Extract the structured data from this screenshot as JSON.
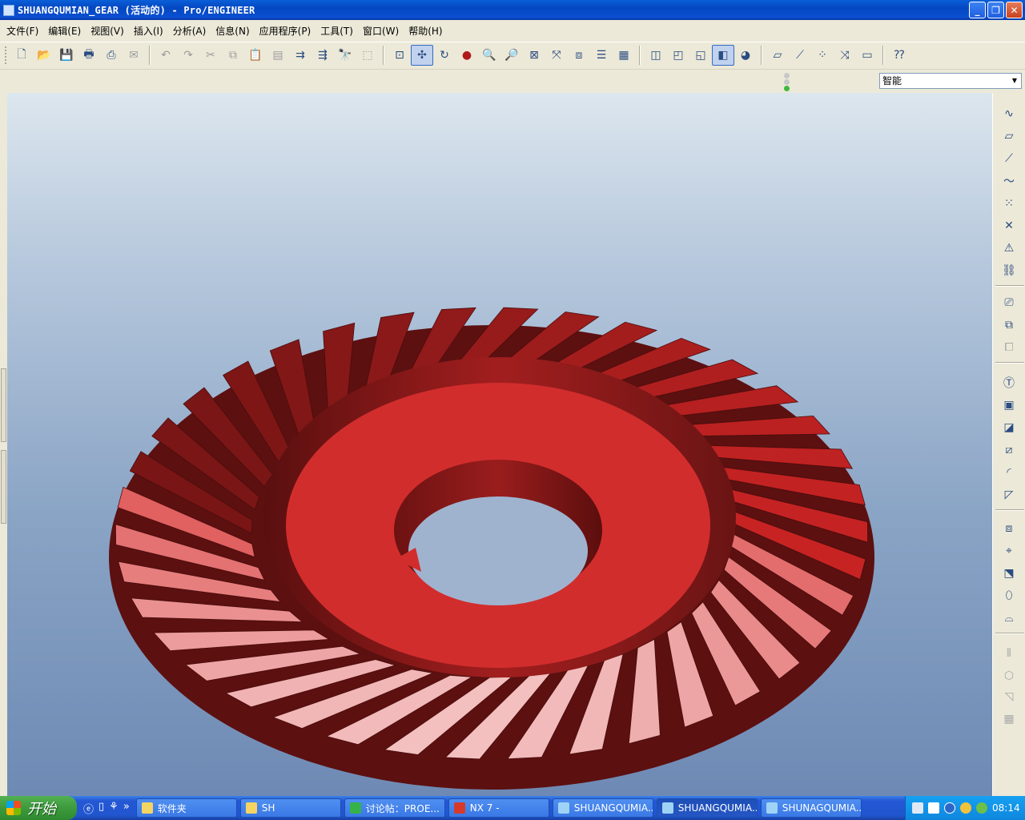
{
  "window": {
    "title": "SHUANGQUMIAN_GEAR (活动的) - Pro/ENGINEER",
    "controls": {
      "minimize": "_",
      "maximize": "❐",
      "close": "✕"
    }
  },
  "menu": [
    {
      "label": "文件(F)"
    },
    {
      "label": "编辑(E)"
    },
    {
      "label": "视图(V)"
    },
    {
      "label": "插入(I)"
    },
    {
      "label": "分析(A)"
    },
    {
      "label": "信息(N)"
    },
    {
      "label": "应用程序(P)"
    },
    {
      "label": "工具(T)"
    },
    {
      "label": "窗口(W)"
    },
    {
      "label": "帮助(H)"
    }
  ],
  "toolbar": {
    "icons": [
      "new-file-icon",
      "open-file-icon",
      "save-icon",
      "print-icon",
      "print-preview-icon",
      "email-icon",
      "undo-icon",
      "redo-icon",
      "cut-icon",
      "copy-icon",
      "paste-icon",
      "paste-special-icon",
      "regenerate-icon",
      "regen-manager-icon",
      "find-icon",
      "select-box-icon",
      "repaint-icon",
      "spin-center-icon",
      "orient-mode-icon",
      "appearance-icon",
      "zoom-in-icon",
      "zoom-out-icon",
      "refit-icon",
      "reorient-icon",
      "saved-views-icon",
      "layers-icon",
      "view-manager-icon",
      "wireframe-icon",
      "hidden-line-icon",
      "no-hidden-icon",
      "shading-icon",
      "enhanced-realism-icon",
      "datum-plane-display-icon",
      "datum-axis-display-icon",
      "point-display-icon",
      "csys-display-icon",
      "annotation-display-icon",
      "context-help-icon"
    ],
    "active": [
      "spin-center-icon",
      "shading-icon"
    ]
  },
  "filter": {
    "selected": "智能"
  },
  "model": {
    "name": "SHUANGQUMIAN_GEAR",
    "color": "#d22d2d",
    "background_top": "#dce6ee",
    "background_bottom": "#6e8ab4"
  },
  "rightbar": {
    "icons": [
      "sketch-icon",
      "datum-plane-icon",
      "datum-axis-icon",
      "datum-curve-icon",
      "datum-point-icon",
      "offset-point-icon",
      "csys-icon",
      "analysis-feature-icon",
      "note-icon",
      "annotation-feature-icon",
      "symbol-icon",
      "hole-icon",
      "shell-icon",
      "rib-icon",
      "draft-icon",
      "round-icon",
      "chamfer-icon",
      "pattern-icon",
      "mirror-icon",
      "merge-icon",
      "trim-icon",
      "intersect-icon",
      "thicken-icon",
      "solidify-icon",
      "offset-icon",
      "extend-icon"
    ]
  },
  "taskbar": {
    "start_label": "开始",
    "tasks": [
      {
        "label": "软件夹",
        "color": "#f6d463"
      },
      {
        "label": "SH",
        "color": "#f6d463"
      },
      {
        "label": "讨论帖：PROE...",
        "color": "#35b34a"
      },
      {
        "label": "NX 7 -",
        "color": "#d73a2b"
      },
      {
        "label": "SHUANGQUMIA...",
        "color": "#9fd3f5"
      },
      {
        "label": "SHUANGQUMIA...",
        "color": "#9fd3f5",
        "active": true
      },
      {
        "label": "SHUNAGQUMIA...",
        "color": "#9fd3f5"
      }
    ],
    "clock": "08:14"
  }
}
